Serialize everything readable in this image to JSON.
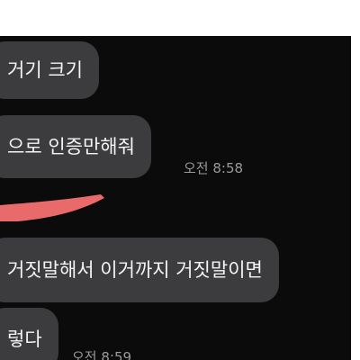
{
  "messages": [
    {
      "text": "거기 크기"
    },
    {
      "text": "으로 인증만해줘",
      "time": "오전 8:58"
    },
    {
      "text": "거짓말해서 이거까지 거짓말이면"
    },
    {
      "text": "렇다",
      "time": "오전 8:59"
    }
  ],
  "colors": {
    "background": "#0b0b0b",
    "bubble": "#3c3c3e",
    "text": "#f4f4f4",
    "timestamp": "#9a9a9a",
    "redaction_mark": "#e86a6a"
  }
}
